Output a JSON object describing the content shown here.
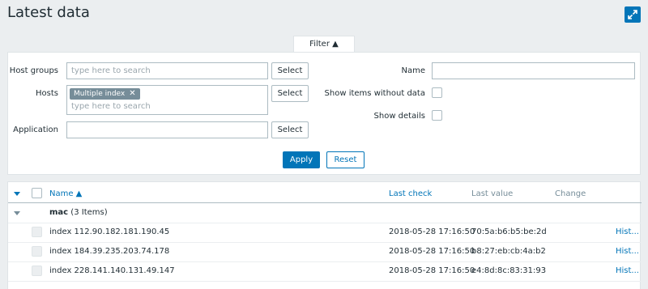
{
  "header": {
    "title": "Latest data"
  },
  "filter": {
    "tab_label": "Filter ▲",
    "host_groups": {
      "label": "Host groups",
      "placeholder": "type here to search",
      "select_label": "Select"
    },
    "hosts": {
      "label": "Hosts",
      "chip": "Multiple index",
      "placeholder": "type here to search",
      "select_label": "Select"
    },
    "application": {
      "label": "Application",
      "value": "",
      "select_label": "Select"
    },
    "name": {
      "label": "Name",
      "value": ""
    },
    "show_items_without_data": {
      "label": "Show items without data",
      "checked": false
    },
    "show_details": {
      "label": "Show details",
      "checked": false
    },
    "apply_label": "Apply",
    "reset_label": "Reset"
  },
  "table": {
    "columns": {
      "name": "Name ▲",
      "last_check": "Last check",
      "last_value": "Last value",
      "change": "Change"
    },
    "group": {
      "name": "mac",
      "count": "(3 Items)"
    },
    "rows": [
      {
        "name": "index 112.90.182.181.190.45",
        "last_check": "2018-05-28 17:16:50",
        "last_value": "70:5a:b6:b5:be:2d",
        "history": "Hist..."
      },
      {
        "name": "index 184.39.235.203.74.178",
        "last_check": "2018-05-28 17:16:50",
        "last_value": "b8:27:eb:cb:4a:b2",
        "history": "Hist..."
      },
      {
        "name": "index 228.141.140.131.49.147",
        "last_check": "2018-05-28 17:16:50",
        "last_value": "e4:8d:8c:83:31:93",
        "history": "Hist..."
      }
    ]
  }
}
